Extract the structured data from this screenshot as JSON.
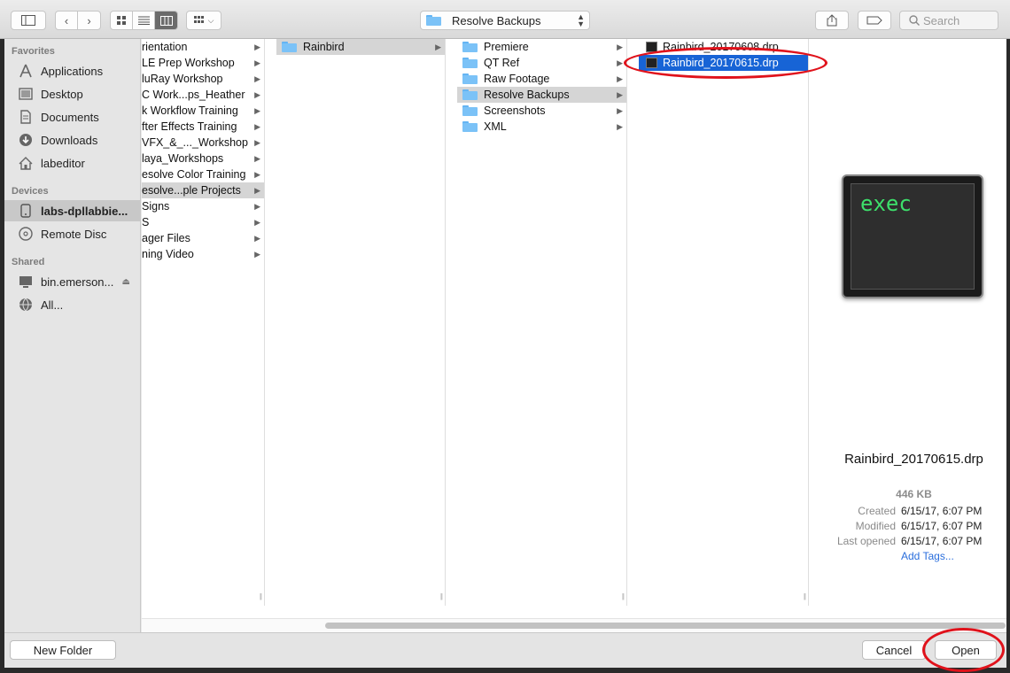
{
  "toolbar": {
    "path_label": "Resolve Backups",
    "search_placeholder": "Search"
  },
  "sidebar": {
    "sections": [
      {
        "header": "Favorites",
        "items": [
          {
            "label": "Applications",
            "icon": "applications-icon"
          },
          {
            "label": "Desktop",
            "icon": "desktop-icon"
          },
          {
            "label": "Documents",
            "icon": "documents-icon"
          },
          {
            "label": "Downloads",
            "icon": "downloads-icon"
          },
          {
            "label": "labeditor",
            "icon": "home-icon"
          }
        ]
      },
      {
        "header": "Devices",
        "items": [
          {
            "label": "labs-dpllabbie...",
            "icon": "drive-icon"
          },
          {
            "label": "Remote Disc",
            "icon": "disc-icon"
          }
        ]
      },
      {
        "header": "Shared",
        "items": [
          {
            "label": "bin.emerson...",
            "icon": "computer-icon"
          },
          {
            "label": "All...",
            "icon": "network-icon"
          }
        ]
      }
    ]
  },
  "columns": {
    "col1": [
      "rientation",
      "LE Prep Workshop",
      "luRay Workshop",
      "C Work...ps_Heather",
      "k Workflow Training",
      "fter Effects Training",
      "VFX_&_..._Workshop",
      "laya_Workshops",
      "esolve Color Training",
      "esolve...ple Projects",
      " Signs",
      "S",
      "ager Files",
      "ning Video"
    ],
    "col2": [
      "Rainbird"
    ],
    "col3": [
      "Premiere",
      "QT Ref",
      "Raw Footage",
      "Resolve Backups",
      "Screenshots",
      "XML"
    ],
    "col4": [
      "Rainbird_20170608.drp",
      "Rainbird_20170615.drp"
    ]
  },
  "preview": {
    "icon_text": "exec",
    "filename": "Rainbird_20170615.drp",
    "size": "446 KB",
    "created_label": "Created",
    "created": "6/15/17, 6:07 PM",
    "modified_label": "Modified",
    "modified": "6/15/17, 6:07 PM",
    "last_opened_label": "Last opened",
    "last_opened": "6/15/17, 6:07 PM",
    "add_tags": "Add Tags..."
  },
  "buttons": {
    "new_folder": "New Folder",
    "cancel": "Cancel",
    "open": "Open"
  },
  "colors": {
    "selection_blue": "#1764d6",
    "annotation_red": "#e0121b",
    "exec_green": "#3de06b"
  }
}
